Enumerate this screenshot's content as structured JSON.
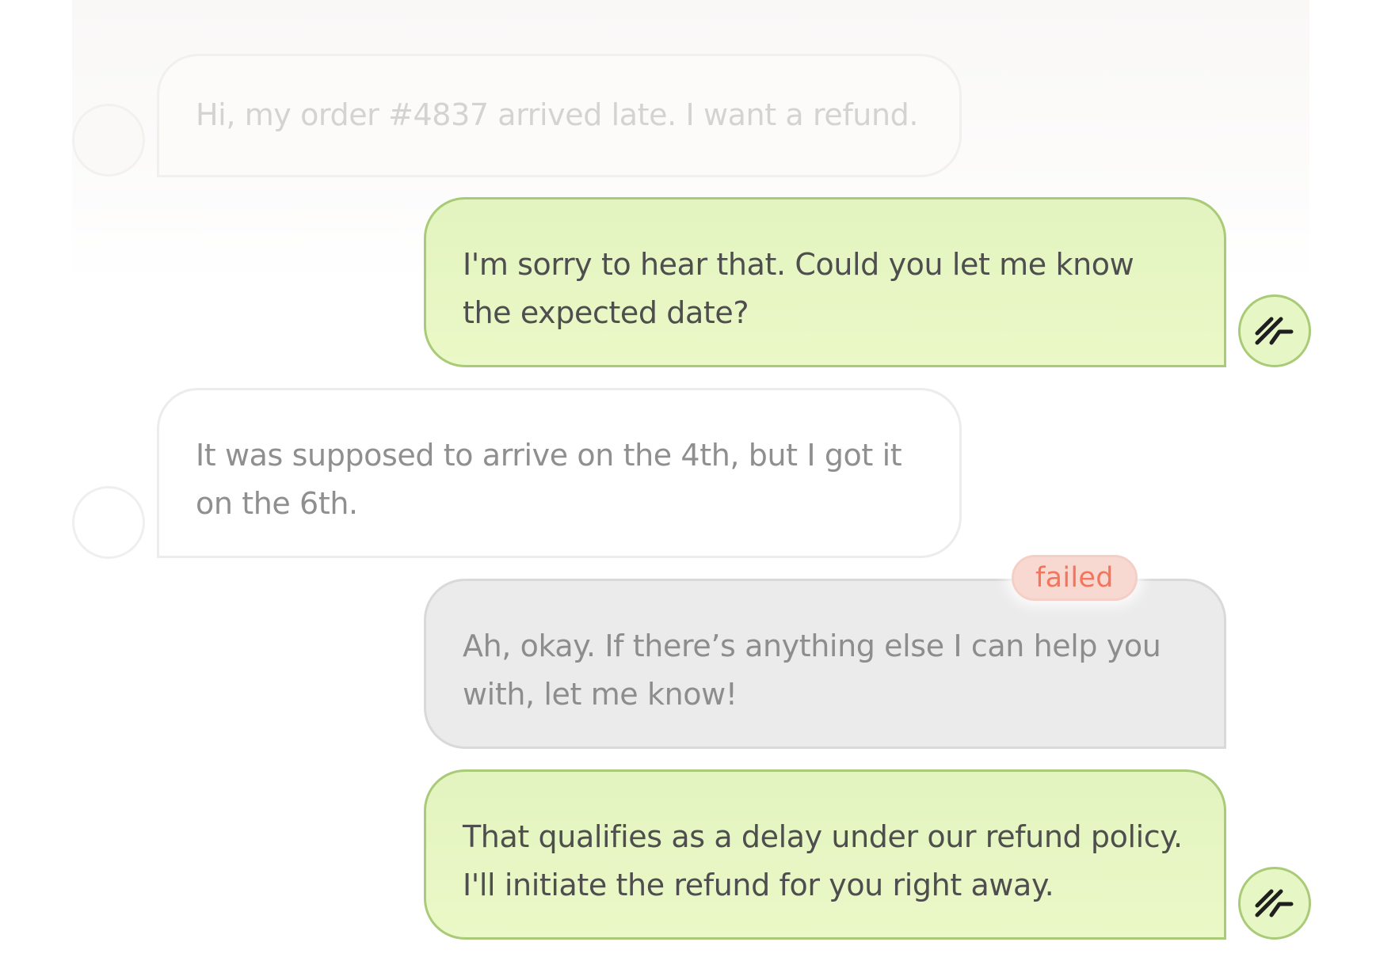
{
  "conversation": {
    "messages": [
      {
        "role": "customer",
        "text": "Hi, my order #4837 arrived late. I want a refund.",
        "faded": true
      },
      {
        "role": "agent",
        "text": "I'm sorry to hear that. Could you let me know the expected date?"
      },
      {
        "role": "customer",
        "text": "It was supposed to arrive on the 4th, but I got it on the 6th."
      },
      {
        "role": "agent",
        "text": "Ah, okay. If there’s anything else I can help you with, let me know!",
        "status": "failed"
      },
      {
        "role": "agent",
        "text": "That qualifies as a delay under our refund policy. I'll initiate the refund for you right away."
      }
    ]
  },
  "icons": {
    "customer_avatar": "empty-circle-avatar",
    "agent_avatar": "zigzag-logo-icon"
  },
  "colors": {
    "agent_bubble_bg": "#e8f7c4",
    "agent_bubble_border": "#a9cb78",
    "failed_bubble_bg": "#ebebeb",
    "failed_badge_bg": "#f8d9d2",
    "failed_badge_text": "#f2755c",
    "customer_bubble_border": "#ececec"
  }
}
